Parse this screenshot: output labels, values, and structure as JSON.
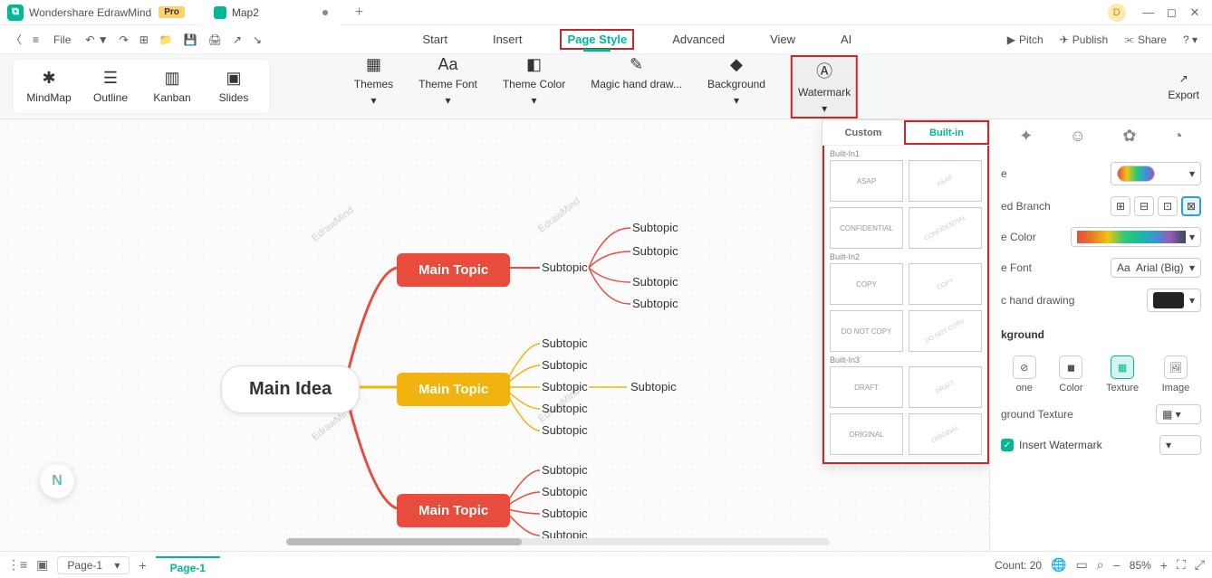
{
  "titlebar": {
    "app_name": "Wondershare EdrawMind",
    "pro_badge": "Pro",
    "tab_name": "Map2",
    "user_initial": "D"
  },
  "menurow": {
    "file_label": "File",
    "tabs": [
      "Start",
      "Insert",
      "Page Style",
      "Advanced",
      "View",
      "AI"
    ],
    "active_tab": "Page Style",
    "actions": {
      "pitch": "Pitch",
      "publish": "Publish",
      "share": "Share"
    }
  },
  "viewmodes": {
    "mindmap": "MindMap",
    "outline": "Outline",
    "kanban": "Kanban",
    "slides": "Slides"
  },
  "style_tools": {
    "themes": "Themes",
    "font": "Theme Font",
    "color": "Theme Color",
    "hand": "Magic hand draw...",
    "background": "Background",
    "watermark": "Watermark",
    "export": "Export"
  },
  "mindmap": {
    "central": "Main Idea",
    "topics": [
      "Main Topic",
      "Main Topic",
      "Main Topic"
    ],
    "subtopic_label": "Subtopic",
    "watermark_text": "EdrawMind"
  },
  "watermark_popup": {
    "tab_custom": "Custom",
    "tab_builtin": "Built-in",
    "groups": [
      {
        "label": "Built-In1",
        "items": [
          "ASAP",
          "ASAP",
          "CONFIDENTIAL",
          "CONFIDENTIAL"
        ]
      },
      {
        "label": "Built-In2",
        "items": [
          "COPY",
          "COPY",
          "DO NOT COPY",
          "DO NOT COPY"
        ]
      },
      {
        "label": "Built-In3",
        "items": [
          "DRAFT",
          "DRAFT",
          "ORIGINAL",
          "ORIGINAL"
        ]
      }
    ]
  },
  "rightpanel": {
    "theme_label": "e",
    "branch_label": "ed Branch",
    "color_label": "e Color",
    "font_label": "e Font",
    "font_value": "Arial (Big)",
    "hand_label": "c hand drawing",
    "bg_section": "kground",
    "bg_opts": {
      "none": "one",
      "color": "Color",
      "texture": "Texture",
      "image": "Image"
    },
    "texture_label": "ground Texture",
    "insert_wm": "Insert Watermark"
  },
  "statusbar": {
    "page_sel": "Page-1",
    "page_tab": "Page-1",
    "count_label": "Count: 20",
    "zoom": "85%"
  }
}
